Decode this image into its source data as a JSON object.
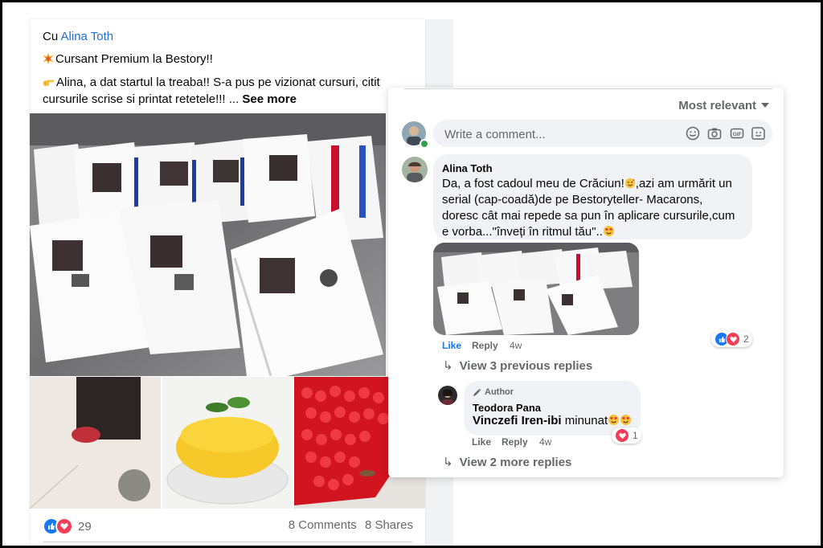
{
  "post": {
    "with_prefix": "Cu",
    "with_name": "Alina Toth",
    "line1": "Cursant Premium la Bestory!!",
    "line2": "Alina, a dat startul la treaba!! S-a pus pe vizionat cursuri, citit cursurile scrise si printat retetele!!! ...",
    "see_more": "See more",
    "reactions_count": "29",
    "comments_count": "8 Comments",
    "shares_count": "8 Shares"
  },
  "comments": {
    "sort_label": "Most relevant",
    "write_placeholder": "Write a comment...",
    "toolbar_icons": [
      "emoji-icon",
      "camera-icon",
      "gif-icon",
      "sticker-icon"
    ],
    "comment1": {
      "author": "Alina Toth",
      "text_a": "Da, a fost cadoul meu de Crăciun!",
      "text_b": ",azi am urmărit un serial (cap-coadă)de pe Bestoryteller- Macarons, doresc cât mai repede sa pun în aplicare cursurile,cum e vorba...\"înveți în ritmul tău\"..",
      "like": "Like",
      "reply": "Reply",
      "age": "4w",
      "reaction_count": "2"
    },
    "view_previous": "View 3 previous replies",
    "reply1": {
      "badge": "Author",
      "author": "Teodora Pana",
      "mention": "Vinczefi Iren-ibi",
      "text": " minunat",
      "like": "Like",
      "reply": "Reply",
      "age": "4w",
      "reaction_count": "1"
    },
    "view_more": "View 2 more replies"
  },
  "colors": {
    "link_blue": "#216fdb",
    "like_blue": "#1877f2",
    "love_red": "#f33e58",
    "muted_gray": "#65676b",
    "bubble_gray": "#f0f2f5"
  }
}
